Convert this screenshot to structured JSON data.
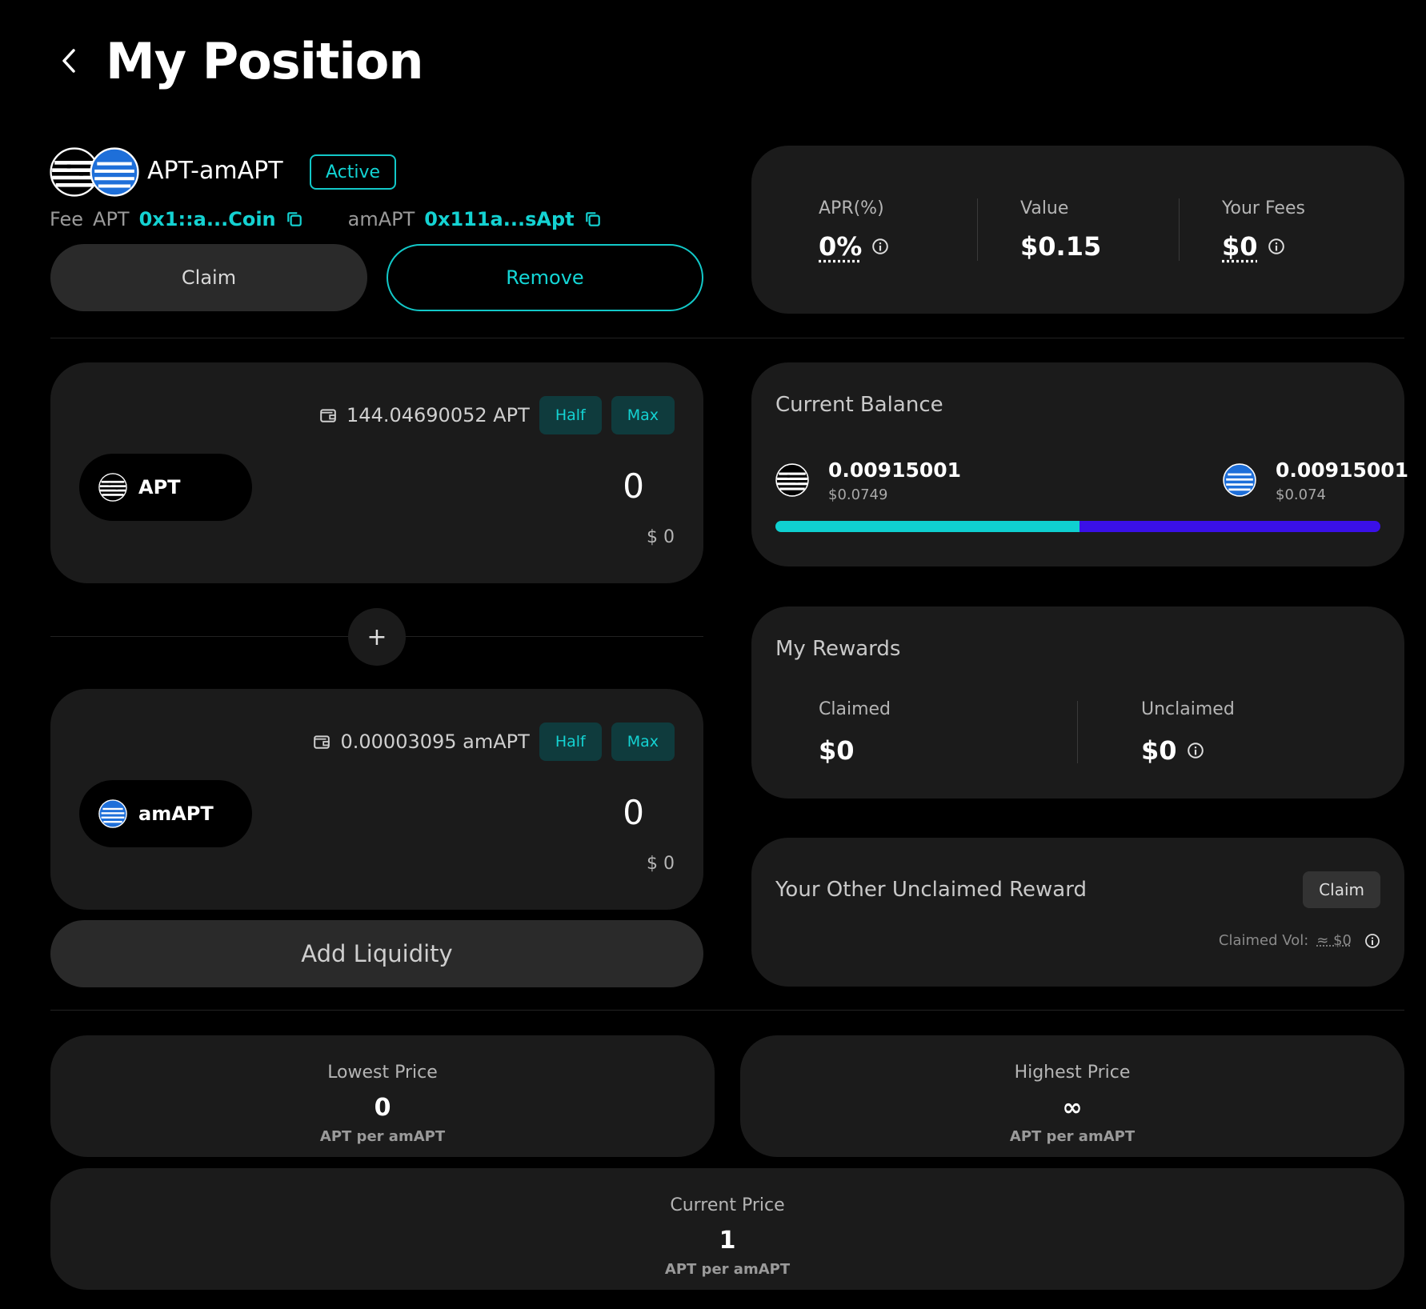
{
  "header": {
    "title": "My Position"
  },
  "pair": {
    "name": "APT-amAPT",
    "status": "Active",
    "fee_label": "Fee",
    "token_a_label": "APT",
    "token_a_address": "0x1::a...Coin",
    "token_b_label": "amAPT",
    "token_b_address": "0x111a...sApt"
  },
  "actions": {
    "claim_label": "Claim",
    "remove_label": "Remove",
    "add_liquidity_label": "Add Liquidity"
  },
  "stats": {
    "apr_label": "APR(%)",
    "apr_value": "0%",
    "value_label": "Value",
    "value_value": "$0.15",
    "fees_label": "Your Fees",
    "fees_value": "$0"
  },
  "inputs": [
    {
      "balance": "144.04690052 APT",
      "half": "Half",
      "max": "Max",
      "token": "APT",
      "amount": "0",
      "usd": "$ 0"
    },
    {
      "balance": "0.00003095 amAPT",
      "half": "Half",
      "max": "Max",
      "token": "amAPT",
      "amount": "0",
      "usd": "$ 0"
    }
  ],
  "plus_symbol": "+",
  "current_balance": {
    "title": "Current Balance",
    "a_amount": "0.00915001",
    "a_usd": "$0.0749",
    "b_amount": "0.00915001",
    "b_usd": "$0.074",
    "a_share": 0.503
  },
  "rewards": {
    "title": "My Rewards",
    "claimed_label": "Claimed",
    "claimed_value": "$0",
    "unclaimed_label": "Unclaimed",
    "unclaimed_value": "$0"
  },
  "other_rewards": {
    "title": "Your Other Unclaimed Reward",
    "claim_label": "Claim",
    "claimed_vol_label": "Claimed Vol:",
    "claimed_vol_value": "≈ $0"
  },
  "prices": {
    "lowest_label": "Lowest Price",
    "lowest_value": "0",
    "lowest_unit": "APT per amAPT",
    "highest_label": "Highest Price",
    "highest_value": "∞",
    "highest_unit": "APT per amAPT",
    "current_label": "Current Price",
    "current_value": "1",
    "current_unit": "APT per amAPT"
  },
  "colors": {
    "accent": "#14d2d2",
    "bar_a": "#0fd0d0",
    "bar_b": "#3a10e8",
    "card": "#1b1b1b"
  },
  "icons": [
    "chevron-left-icon",
    "apt-token-icon",
    "amapt-token-icon",
    "copy-icon",
    "info-icon",
    "wallet-icon"
  ]
}
